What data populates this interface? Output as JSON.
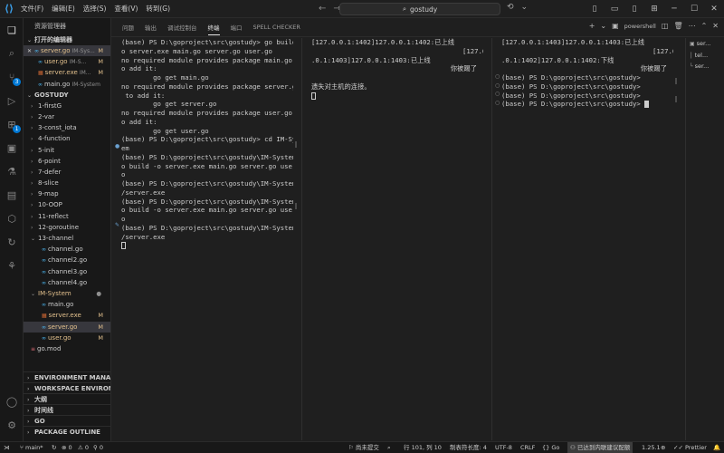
{
  "menu": [
    "文件(F)",
    "编辑(E)",
    "选择(S)",
    "查看(V)",
    "转到(G)"
  ],
  "search": {
    "text": "gostudy"
  },
  "sidebar": {
    "title": "资源管理器",
    "open_editors_label": "打开的编辑器",
    "open_editors": [
      {
        "name": "server.go",
        "path": "IM-Sys...",
        "status": "M"
      },
      {
        "name": "user.go",
        "path": "IM-S...",
        "status": "M"
      },
      {
        "name": "server.exe",
        "path": "IM...",
        "status": "M"
      },
      {
        "name": "main.go",
        "path": "IM-System",
        "status": ""
      }
    ],
    "root_label": "GOSTUDY",
    "folders": [
      "1-firstG",
      "2-var",
      "3-const_iota",
      "4-function",
      "5-init",
      "6-point",
      "7-defer",
      "8-slice",
      "9-map",
      "10-OOP",
      "11-reflect",
      "12-goroutine",
      "13-channel"
    ],
    "channel_files": [
      "channel.go",
      "channel2.go",
      "channel3.go",
      "channel4.go"
    ],
    "im_system_label": "IM-System",
    "im_files": [
      {
        "name": "main.go",
        "status": ""
      },
      {
        "name": "server.exe",
        "status": "M"
      },
      {
        "name": "server.go",
        "status": "M"
      },
      {
        "name": "user.go",
        "status": "M"
      }
    ],
    "go_mod": "go.mod",
    "outline": [
      "ENVIRONMENT MANAGE...",
      "WORKSPACE ENVIRONME...",
      "大纲",
      "时间线",
      "GO",
      "PACKAGE OUTLINE"
    ]
  },
  "panel": {
    "tabs": [
      "问题",
      "输出",
      "调试控制台",
      "终端",
      "端口",
      "SPELL CHECKER"
    ],
    "shell": "powershell"
  },
  "terminal1": [
    "(base) PS D:\\goproject\\src\\gostudy> go build -",
    "o server.exe main.go server.go user.go",
    "no required module provides package main.go; t",
    "o add it:",
    "        go get main.go",
    "no required module provides package server.go;",
    " to add it:",
    "        go get server.go",
    "no required module provides package user.go; t",
    "o add it:",
    "        go get user.go",
    "(base) PS D:\\goproject\\src\\gostudy> cd IM-Syst",
    "em",
    "(base) PS D:\\goproject\\src\\gostudy\\IM-System> g",
    "o build -o server.exe main.go server.go user.g",
    "o",
    "(base) PS D:\\goproject\\src\\gostudy\\IM-System> .",
    "/server.exe",
    "(base) PS D:\\goproject\\src\\gostudy\\IM-System> g",
    "o build -o server.exe main.go server.go user.g",
    "o",
    "(base) PS D:\\goproject\\src\\gostudy\\IM-System> .",
    "/server.exe"
  ],
  "terminal2": [
    "[127.0.0.1:1402]127.0.0.1:1402:已上线",
    "                                      [127.0",
    ".0.1:1403]127.0.0.1:1403:已上线",
    "                                   你被踢了",
    "",
    "遗失对主机的连接。"
  ],
  "terminal3": [
    "[127.0.0.1:1403]127.0.0.1:1403:已上线",
    "                                      [127.0",
    ".0.1:1402]127.0.0.1:1402:下线",
    "                                   你被踢了    c",
    "(base) PS D:\\goproject\\src\\gostudy>",
    "(base) PS D:\\goproject\\src\\gostudy>",
    "(base) PS D:\\goproject\\src\\gostudy>",
    "(base) PS D:\\goproject\\src\\gostudy>"
  ],
  "terminal_list": [
    "ser...",
    "tel...",
    "ser..."
  ],
  "status": {
    "branch": "main*",
    "errors": "0",
    "warnings": "0",
    "ports": "0",
    "not_committed": "尚未提交",
    "position": "行 101, 列 10",
    "tab_size": "制表符长度: 4",
    "encoding": "UTF-8",
    "eol": "CRLF",
    "language": "Go",
    "sync": "已达到内联建议配额",
    "go_version": "1.25.1",
    "prettier": "Prettier"
  }
}
